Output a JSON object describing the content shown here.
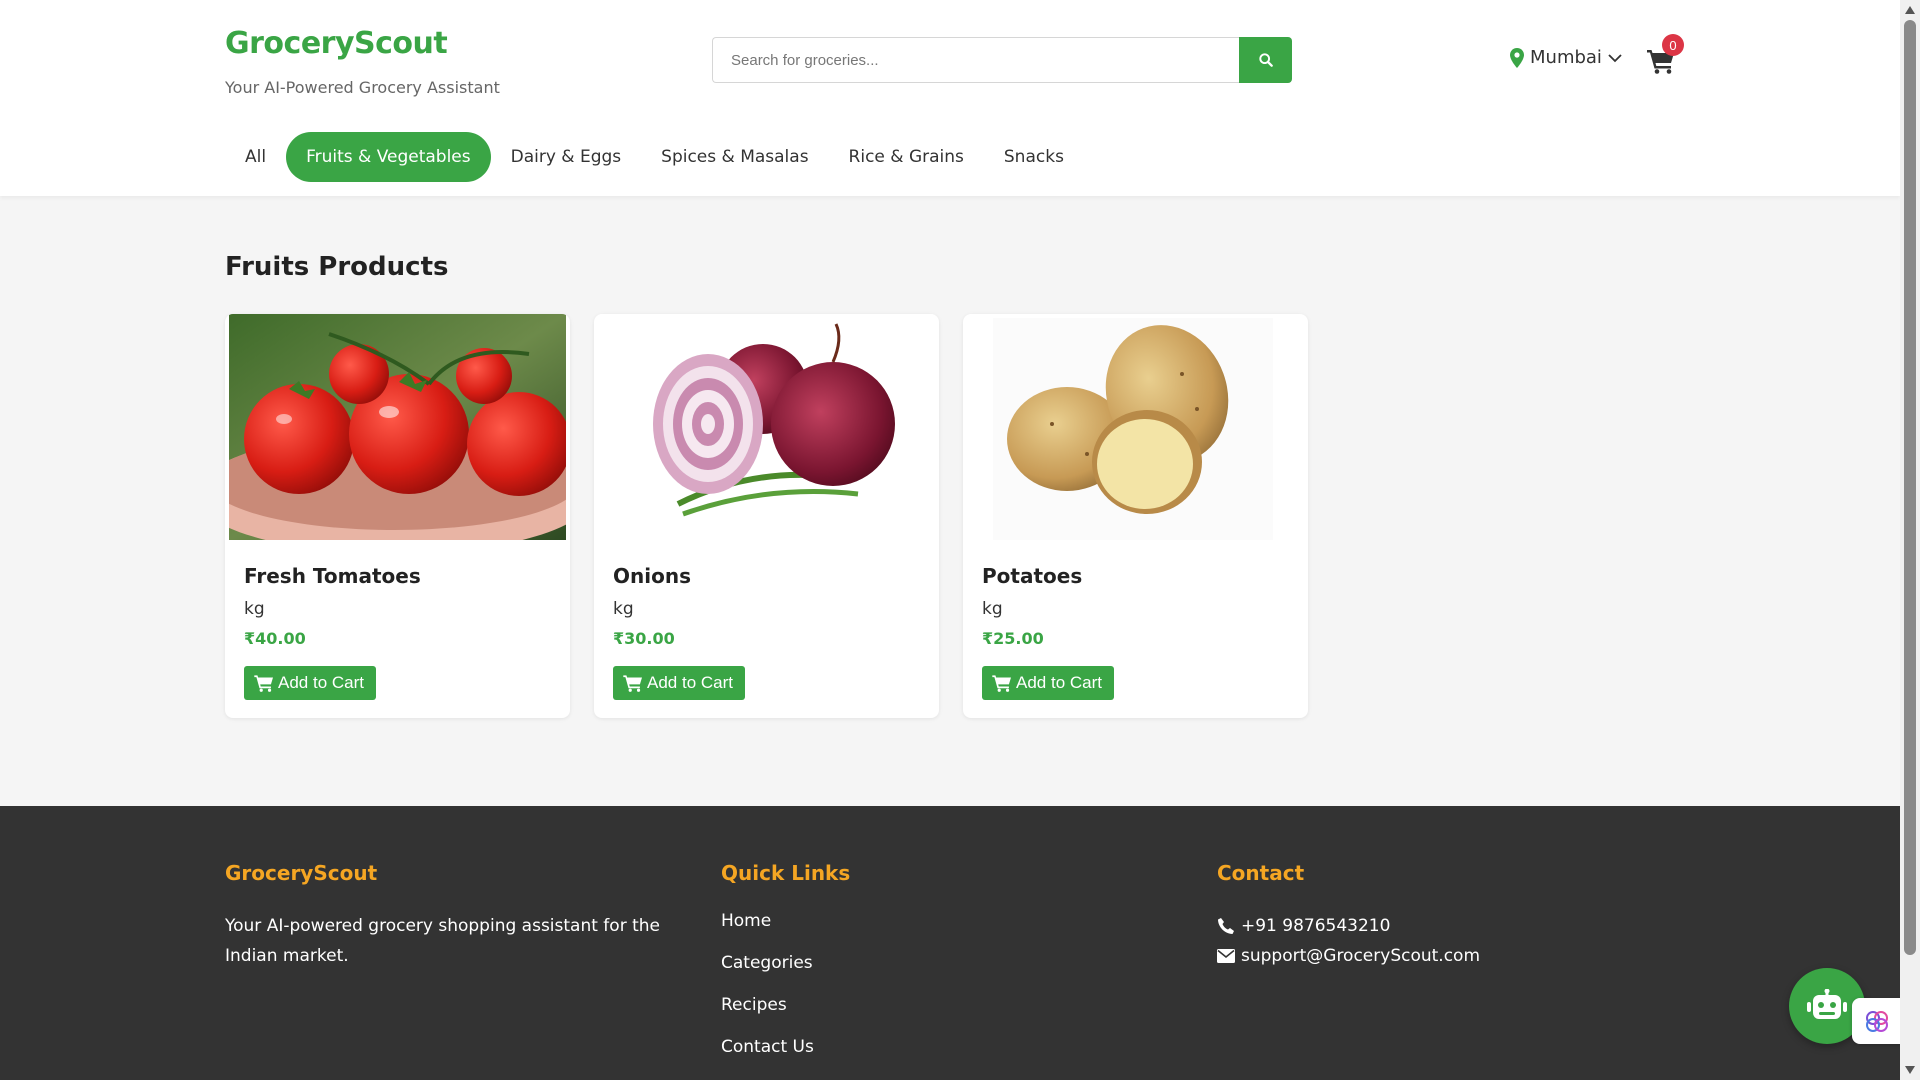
{
  "header": {
    "brand": "GroceryScout",
    "tagline": "Your AI-Powered Grocery Assistant",
    "search_placeholder": "Search for groceries...",
    "location": "Mumbai",
    "cart_count": "0"
  },
  "tabs": [
    {
      "label": "All",
      "active": false
    },
    {
      "label": "Fruits & Vegetables",
      "active": true
    },
    {
      "label": "Dairy & Eggs",
      "active": false
    },
    {
      "label": "Spices & Masalas",
      "active": false
    },
    {
      "label": "Rice & Grains",
      "active": false
    },
    {
      "label": "Snacks",
      "active": false
    }
  ],
  "main": {
    "section_title": "Fruits Products",
    "products": [
      {
        "name": "Fresh Tomatoes",
        "unit": "kg",
        "price": "₹40.00",
        "button": "Add to Cart",
        "image": "tomatoes"
      },
      {
        "name": "Onions",
        "unit": "kg",
        "price": "₹30.00",
        "button": "Add to Cart",
        "image": "onions"
      },
      {
        "name": "Potatoes",
        "unit": "kg",
        "price": "₹25.00",
        "button": "Add to Cart",
        "image": "potatoes"
      }
    ]
  },
  "footer": {
    "brand": {
      "title": "GroceryScout",
      "text": "Your AI-powered grocery shopping assistant for the Indian market."
    },
    "quick_links": {
      "title": "Quick Links",
      "links": [
        "Home",
        "Categories",
        "Recipes",
        "Contact Us"
      ]
    },
    "contact": {
      "title": "Contact",
      "phone": "+91 9876543210",
      "email": "support@GroceryScout.com"
    }
  },
  "colors": {
    "accent": "#3aa545",
    "footer_heading": "#f5a623",
    "badge": "#dc3545",
    "footer_bg": "#333333"
  },
  "icons": [
    "search-icon",
    "location-pin-icon",
    "chevron-down-icon",
    "cart-icon",
    "phone-icon",
    "envelope-icon",
    "robot-icon",
    "brain-icon"
  ]
}
